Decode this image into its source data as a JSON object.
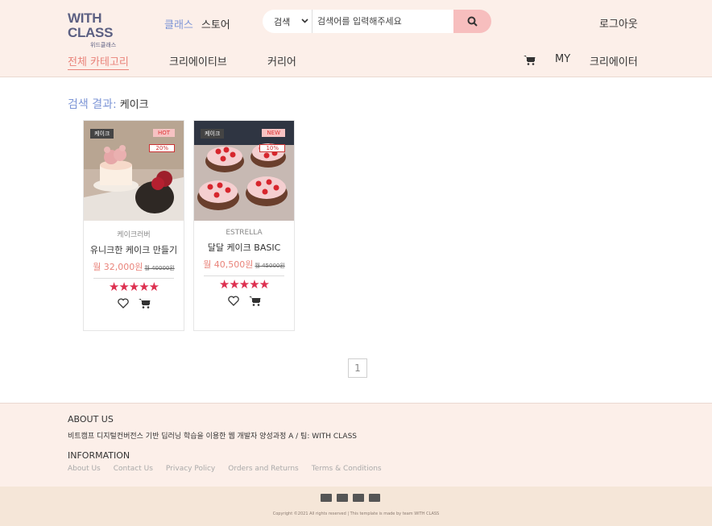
{
  "header": {
    "logo_main": "WITH CLASS",
    "logo_sub": "위드클래스",
    "nav_class": "클래스",
    "nav_store": "스토어",
    "search_select": "검색",
    "search_placeholder": "검색어를 입력해주세요",
    "logout": "로그아웃",
    "cat_all": "전체 카테고리",
    "cat_creative": "크리에이티브",
    "cat_career": "커리어",
    "my": "MY",
    "creator": "크리에이터"
  },
  "result": {
    "label": "검색 결과:",
    "keyword": "케이크"
  },
  "products": [
    {
      "category": "케이크",
      "state": "HOT",
      "sale": "20%",
      "seller": "케이크러버",
      "name": "유니크한 케이크 만들기",
      "price": "월 32,000원",
      "original_price": "월 40000원",
      "stars": "★★★★★"
    },
    {
      "category": "케이크",
      "state": "NEW",
      "sale": "10%",
      "seller": "ESTRELLA",
      "name": "달달 케이크 BASIC",
      "price": "월 40,500원",
      "original_price": "월 45000원",
      "stars": "★★★★★"
    }
  ],
  "pagination": {
    "current": "1"
  },
  "footer": {
    "about_title": "ABOUT US",
    "about_desc": "비트캠프 디지털컨버전스 기반 딥러닝 학습을 이용한 웹 개발자 양성과정 A / 팀: WITH CLASS",
    "info_title": "INFORMATION",
    "links": [
      "About Us",
      "Contact Us",
      "Privacy Policy",
      "Orders and Returns",
      "Terms & Conditions"
    ],
    "copyright": "Copyright ©2021 All rights reserved | This template is made by team WITH CLASS"
  },
  "colors": {
    "header_bg": "#fcefe9",
    "accent": "#e9837a",
    "star": "#dd2f4f",
    "link_blue": "#7d95d6"
  }
}
